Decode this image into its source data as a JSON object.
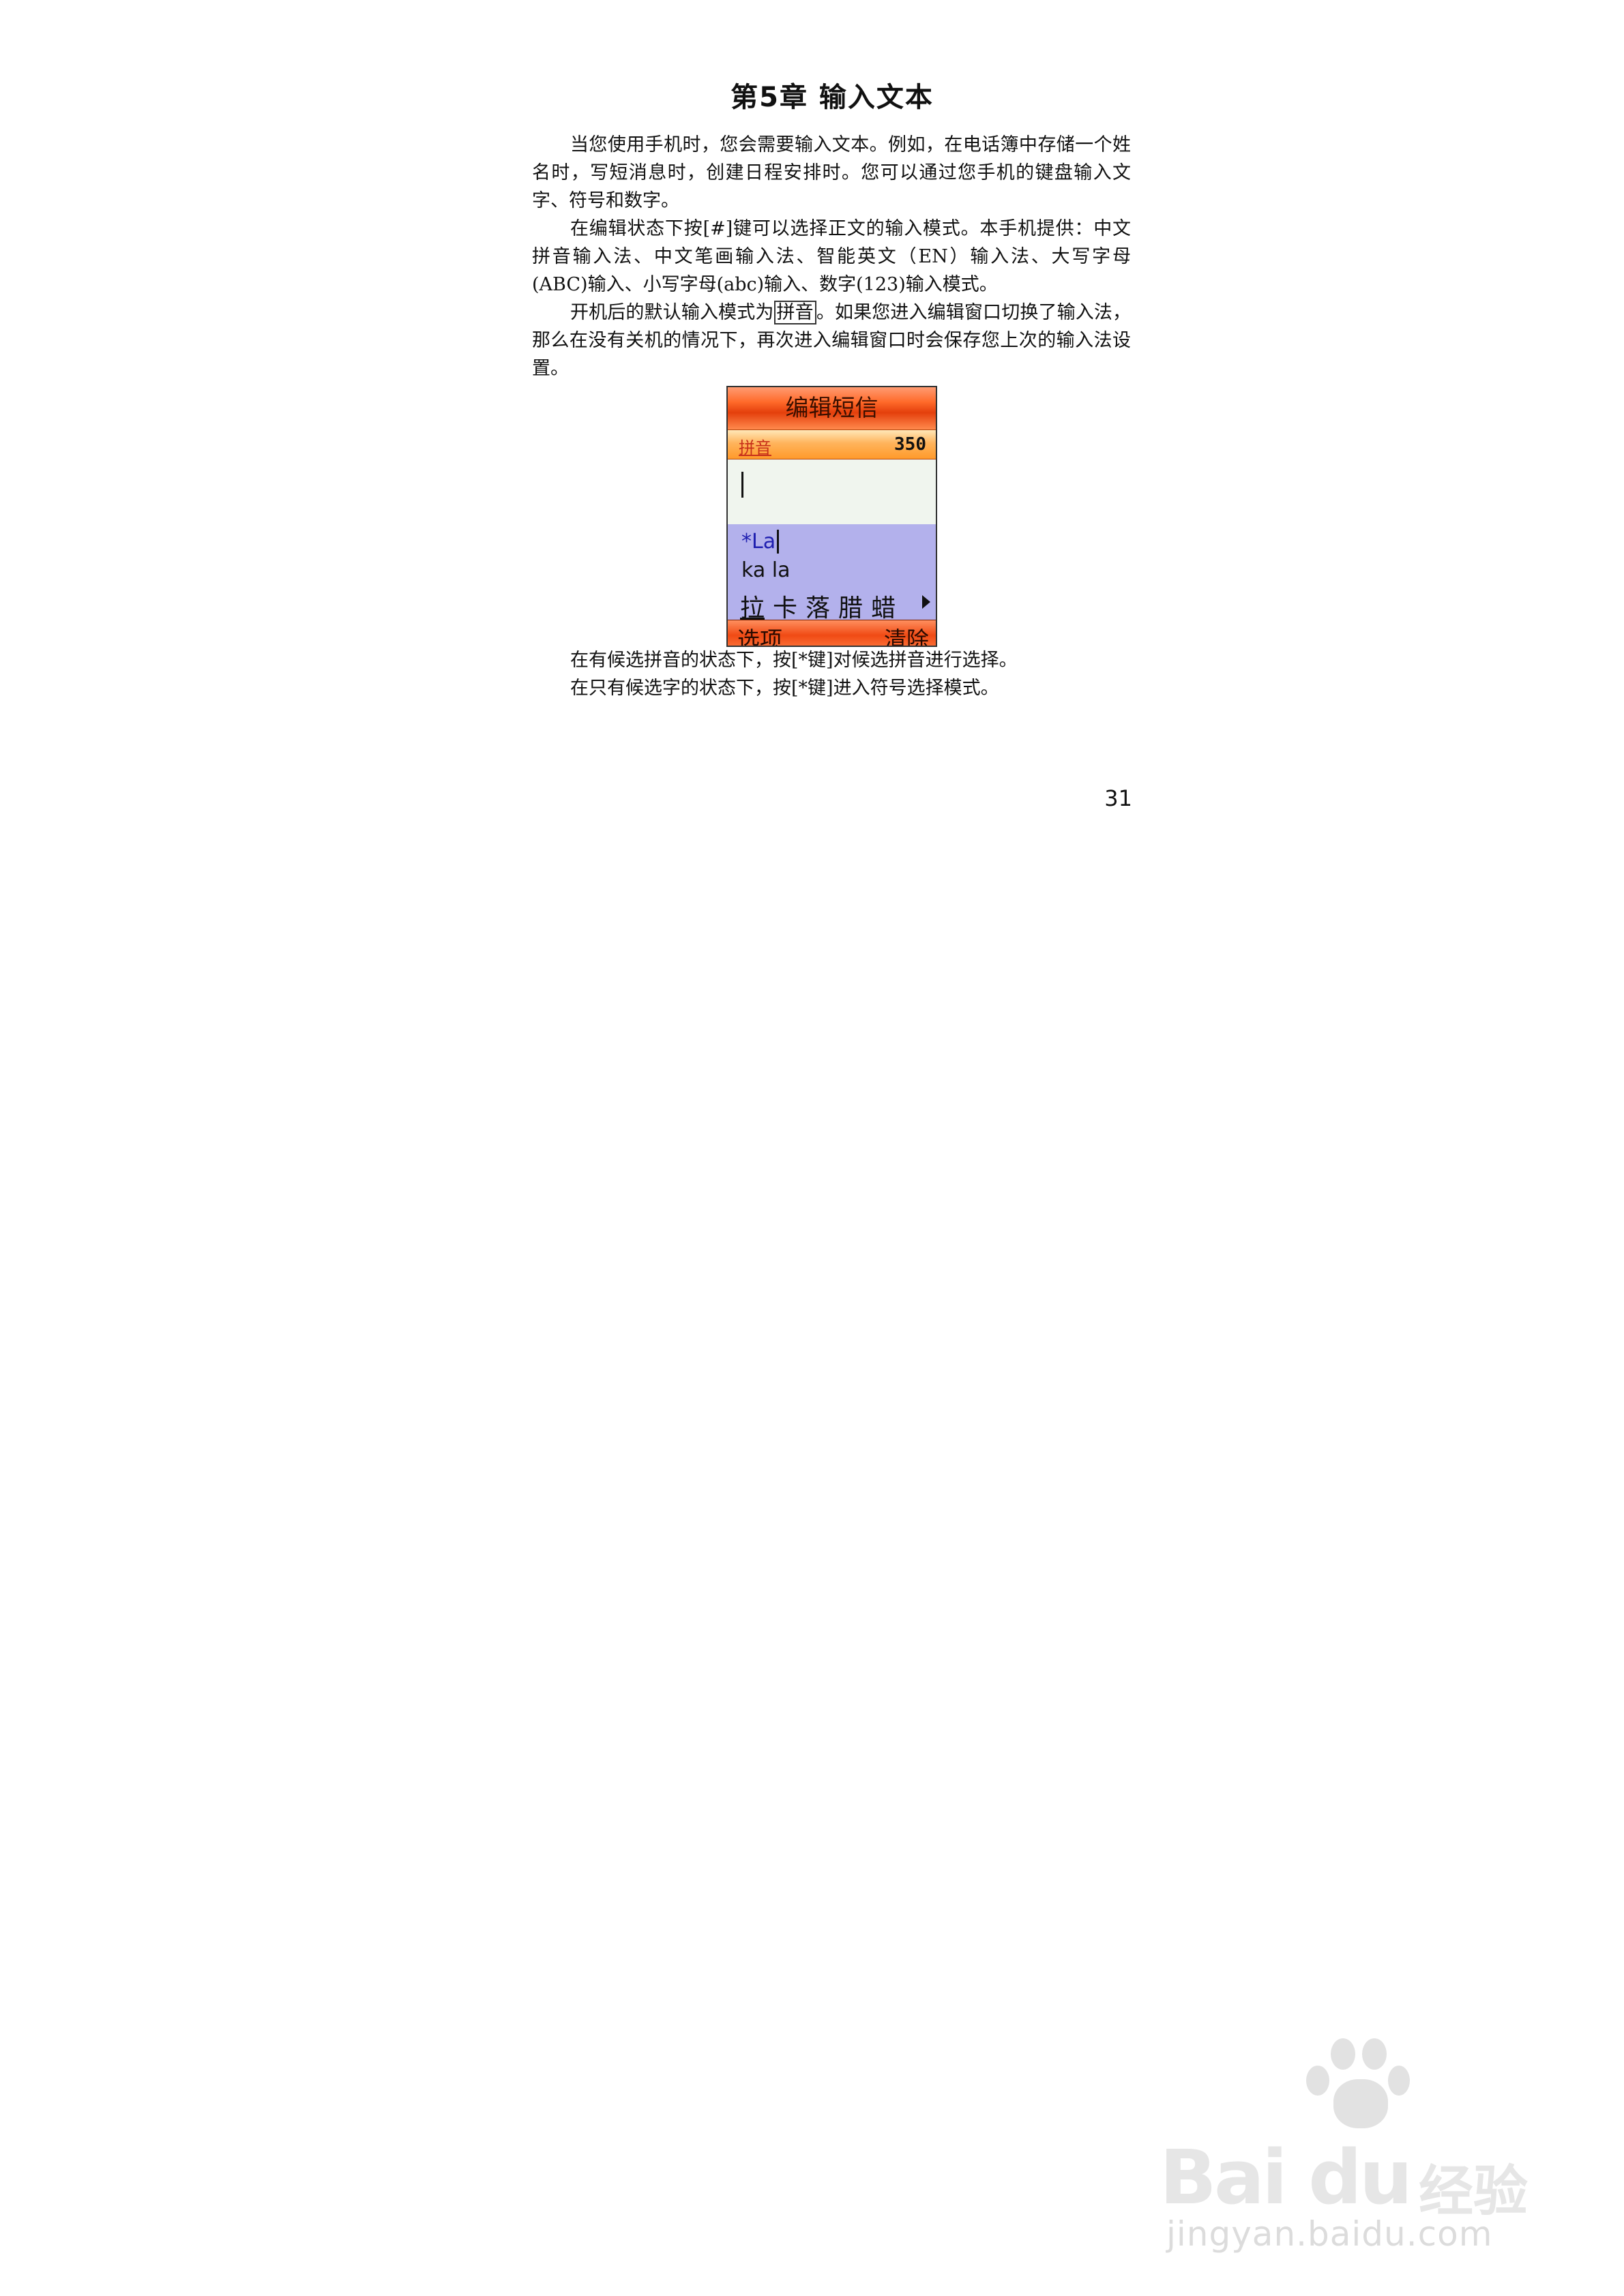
{
  "page": {
    "title": "第5章  输入文本",
    "paragraphs": {
      "p1": "当您使用手机时，您会需要输入文本。例如，在电话簿中存储一个姓名时，写短消息时，创建日程安排时。您可以通过您手机的键盘输入文字、符号和数字。",
      "p2": "在编辑状态下按[#]键可以选择正文的输入模式。本手机提供：中文拼音输入法、中文笔画输入法、智能英文（EN）输入法、大写字母(ABC)输入、小写字母(abc)输入、数字(123)输入模式。",
      "p3_before": "开机后的默认输入模式为",
      "p3_boxed": "拼音",
      "p3_after": "。如果您进入编辑窗口切换了输入法，那么在没有关机的情况下，再次进入编辑窗口时会保存您上次的输入法设置。",
      "p4": "在有候选拼音的状态下，按[*键]对候选拼音进行选择。",
      "p5": "在只有候选字的状态下，按[*键]进入符号选择模式。"
    },
    "page_number": "31"
  },
  "phone": {
    "title": "编辑短信",
    "mode": "拼音",
    "count": "350",
    "input": "*La",
    "pinyin_options": "ka la",
    "chars": [
      "拉",
      "卡",
      "落",
      "腊",
      "蜡"
    ],
    "softkey_left": "选项",
    "softkey_right": "清除"
  },
  "watermark": {
    "brand": "Bai du",
    "product": "经验",
    "url": "jingyan.baidu.com"
  }
}
